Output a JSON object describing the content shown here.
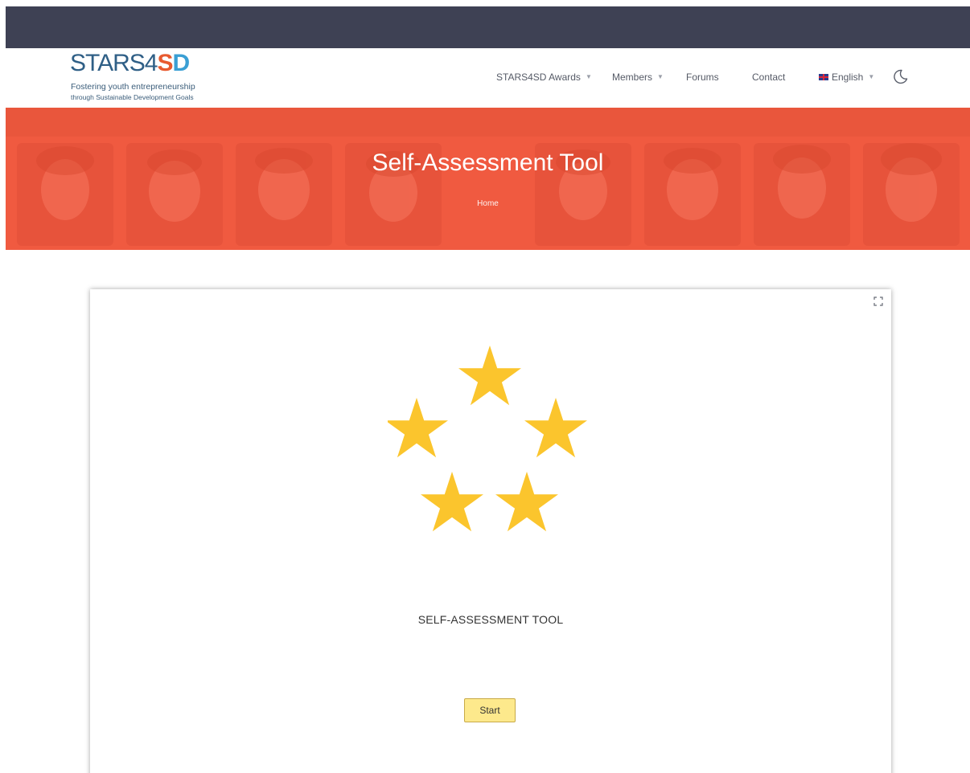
{
  "logo": {
    "title_part1": "STARS4",
    "title_part2": "SD",
    "tagline_line1": "Fostering youth entrepreneurship",
    "tagline_line2": "through Sustainable Development Goals"
  },
  "nav": {
    "items": [
      {
        "label": "STARS4SD Awards",
        "has_dropdown": true
      },
      {
        "label": "Members",
        "has_dropdown": true
      },
      {
        "label": "Forums",
        "has_dropdown": false
      },
      {
        "label": "Contact",
        "has_dropdown": false
      }
    ],
    "language": {
      "label": "English",
      "flag": "uk-flag-icon",
      "has_dropdown": true
    },
    "theme_icon": "moon-icon"
  },
  "hero": {
    "title": "Self-Assessment Tool",
    "breadcrumb": "Home",
    "background_color": "#f05a40"
  },
  "tool": {
    "title": "SELF-ASSESSMENT TOOL",
    "start_label": "Start",
    "icon": "five-stars-icon",
    "star_color": "#fbc52d",
    "button_color": "#fde98c"
  },
  "colors": {
    "top_bar": "#3e4154",
    "accent": "#f05a40"
  }
}
